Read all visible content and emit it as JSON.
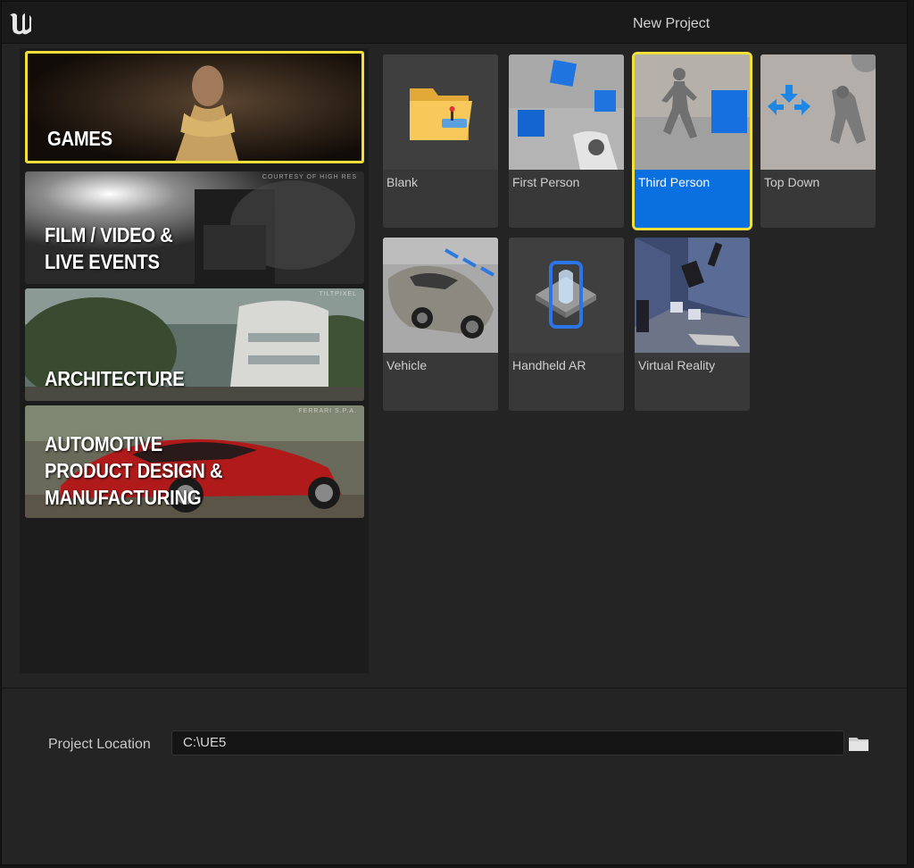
{
  "window": {
    "title": "New Project"
  },
  "categories": [
    {
      "label_line1": "GAMES",
      "label_line2": "",
      "label_line3": "",
      "credit": "",
      "selected": true
    },
    {
      "label_line1": "FILM / VIDEO &",
      "label_line2": "LIVE EVENTS",
      "label_line3": "",
      "credit": "COURTESY OF HIGH RES",
      "selected": false
    },
    {
      "label_line1": "ARCHITECTURE",
      "label_line2": "",
      "label_line3": "",
      "credit": "TILTPIXEL",
      "selected": false
    },
    {
      "label_line1": "AUTOMOTIVE",
      "label_line2": "PRODUCT DESIGN &",
      "label_line3": "MANUFACTURING",
      "credit": "FERRARI S.P.A.",
      "selected": false
    }
  ],
  "templates": [
    {
      "label": "Blank",
      "icon": "folder-icon",
      "selected": false
    },
    {
      "label": "First Person",
      "icon": "first-person-icon",
      "selected": false
    },
    {
      "label": "Third Person",
      "icon": "third-person-icon",
      "selected": true
    },
    {
      "label": "Top Down",
      "icon": "top-down-icon",
      "selected": false
    },
    {
      "label": "Vehicle",
      "icon": "vehicle-icon",
      "selected": false
    },
    {
      "label": "Handheld AR",
      "icon": "handheld-ar-icon",
      "selected": false
    },
    {
      "label": "Virtual Reality",
      "icon": "virtual-reality-icon",
      "selected": false
    }
  ],
  "project_location": {
    "label": "Project Location",
    "value": "C:\\UE5"
  },
  "colors": {
    "accent_selection": "#f3df3a",
    "selected_label_bg": "#0a70e0"
  }
}
